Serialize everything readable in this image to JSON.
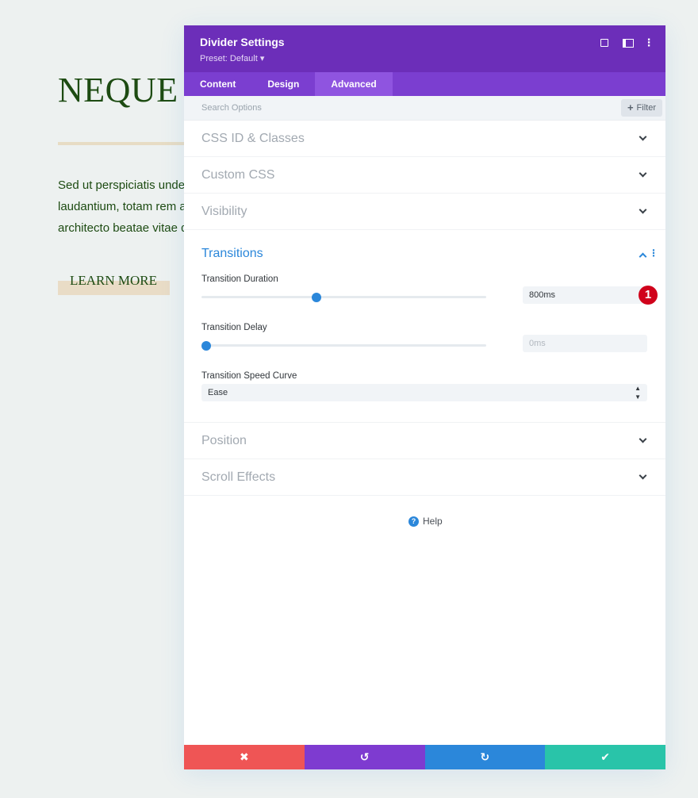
{
  "background": {
    "heading": "NEQUE P",
    "paragraph_lines": [
      "Sed ut perspiciatis unde o",
      "laudantium, totam rem ap",
      "architecto beatae vitae di"
    ],
    "button_label": "LEARN MORE"
  },
  "modal": {
    "title": "Divider Settings",
    "preset": "Preset: Default ▾",
    "tabs": [
      "Content",
      "Design",
      "Advanced"
    ],
    "active_tab": "Advanced",
    "search_placeholder": "Search Options",
    "filter_label": "Filter",
    "sections_top": [
      "CSS ID & Classes",
      "Custom CSS",
      "Visibility"
    ],
    "transitions": {
      "title": "Transitions",
      "duration_label": "Transition Duration",
      "duration_value": "800ms",
      "duration_fraction": 0.4,
      "delay_label": "Transition Delay",
      "delay_value": "0ms",
      "delay_fraction": 0.0,
      "curve_label": "Transition Speed Curve",
      "curve_value": "Ease",
      "badge": "1"
    },
    "sections_bottom": [
      "Position",
      "Scroll Effects"
    ],
    "help_label": "Help"
  },
  "colors": {
    "header": "#6c2eb9",
    "tabs": "#7b3ed0",
    "accent": "#2b87da",
    "cancel": "#ef5555",
    "undo": "#7e3bd0",
    "redo": "#2b87da",
    "save": "#29c4a9",
    "badge": "#d0021b"
  }
}
